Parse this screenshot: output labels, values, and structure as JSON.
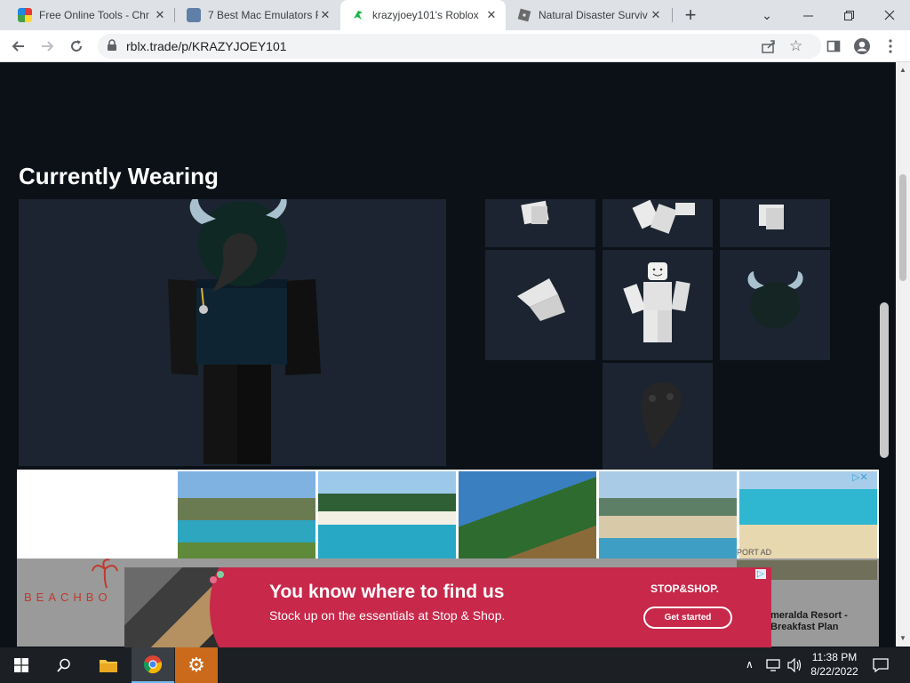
{
  "browser": {
    "tabs": [
      {
        "title": "Free Online Tools - Chr",
        "active": false
      },
      {
        "title": "7 Best Mac Emulators F",
        "active": false
      },
      {
        "title": "krazyjoey101's Roblox",
        "active": true
      },
      {
        "title": "Natural Disaster Surviv",
        "active": false
      }
    ],
    "new_tab_label": "+",
    "url": "rblx.trade/p/KRAZYJOEY101"
  },
  "page": {
    "heading": "Currently Wearing"
  },
  "ads": {
    "resort_logo_text": "BEACHBO",
    "resort_caption": "meralda Resort - Breakfast Plan",
    "resort_tag": "PORT AD",
    "banner_headline": "You know where to find us",
    "banner_subtext": "Stock up on the essentials at Stop & Shop.",
    "banner_brand": "STOP&SHOP.",
    "banner_cta": "Get started"
  },
  "taskbar": {
    "time": "11:38 PM",
    "date": "8/22/2022"
  },
  "colors": {
    "page_bg": "#0b1117",
    "panel_bg": "#1b2430",
    "banner_bg": "#c8284a"
  }
}
